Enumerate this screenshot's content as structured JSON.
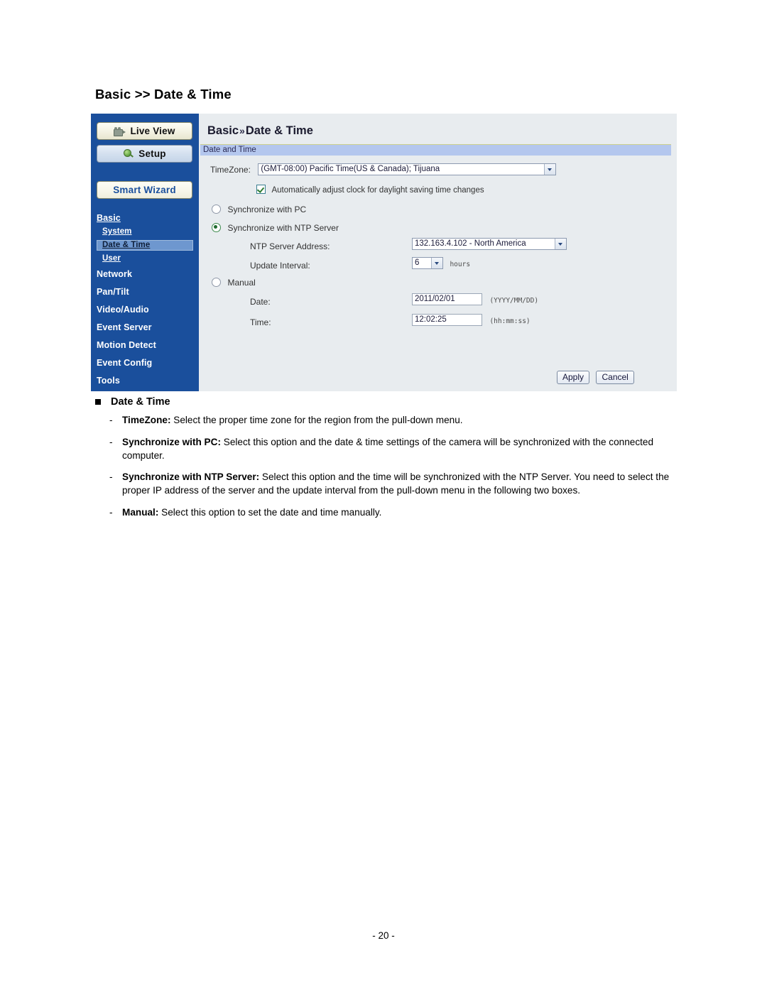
{
  "page": {
    "heading": "Basic >> Date & Time",
    "number": "- 20 -"
  },
  "screenshot": {
    "sidebar": {
      "buttons": [
        {
          "label": "Live View",
          "icon": "video-camera-icon"
        },
        {
          "label": "Setup",
          "icon": "wrench-icon"
        },
        {
          "label": "Smart Wizard",
          "icon": ""
        }
      ],
      "nav": [
        {
          "label": "Basic",
          "level": "top",
          "selected": false
        },
        {
          "label": "System",
          "level": "sub",
          "selected": false
        },
        {
          "label": "Date & Time",
          "level": "sub",
          "selected": true
        },
        {
          "label": "User",
          "level": "sub",
          "selected": false
        },
        {
          "label": "Network",
          "level": "top",
          "selected": false
        },
        {
          "label": "Pan/Tilt",
          "level": "top",
          "selected": false
        },
        {
          "label": "Video/Audio",
          "level": "top",
          "selected": false
        },
        {
          "label": "Event Server",
          "level": "top",
          "selected": false
        },
        {
          "label": "Motion Detect",
          "level": "top",
          "selected": false
        },
        {
          "label": "Event Config",
          "level": "top",
          "selected": false
        },
        {
          "label": "Tools",
          "level": "top",
          "selected": false
        }
      ]
    },
    "panel": {
      "breadcrumb_root": "Basic",
      "breadcrumb_sep": "»",
      "breadcrumb_leaf": "Date & Time",
      "section_title": "Date and Time",
      "timezone_label": "TimeZone:",
      "timezone_value": "(GMT-08:00) Pacific Time(US & Canada); Tijuana",
      "dst_label": "Automatically adjust clock for daylight saving time changes",
      "dst_checked": true,
      "opt_sync_pc": "Synchronize with PC",
      "opt_sync_ntp": "Synchronize with NTP Server",
      "opt_manual": "Manual",
      "selected_option": "ntp",
      "ntp_address_label": "NTP Server Address:",
      "ntp_address_value": "132.163.4.102 - North America",
      "update_interval_label": "Update Interval:",
      "update_interval_value": "6",
      "update_interval_unit": "hours",
      "date_label": "Date:",
      "date_value": "2011/02/01",
      "date_hint": "(YYYY/MM/DD)",
      "time_label": "Time:",
      "time_value": "12:02:25",
      "time_hint": "(hh:mm:ss)",
      "apply_label": "Apply",
      "cancel_label": "Cancel"
    }
  },
  "description": {
    "heading": "Date & Time",
    "items": [
      {
        "dash": "-",
        "term": "TimeZone:",
        "text": " Select the proper time zone for the region from the pull-down menu."
      },
      {
        "dash": "-",
        "term": "Synchronize with PC:",
        "text": " Select this option and the date & time settings of the camera will be synchronized with the connected computer."
      },
      {
        "dash": "-",
        "term": "Synchronize with NTP Server:",
        "text": " Select this option and the time will be synchronized with the NTP Server. You need to select the proper IP address of the server and the update interval from the pull-down menu in the following two boxes."
      },
      {
        "dash": "-",
        "term": "Manual:",
        "text": " Select this option to set the date and time manually."
      }
    ]
  },
  "colors": {
    "sidebar_blue": "#1a4f9c",
    "panel_bg": "#e8ecef",
    "section_bar": "#b4c7ee",
    "nav_highlight": "#6e97cf"
  }
}
